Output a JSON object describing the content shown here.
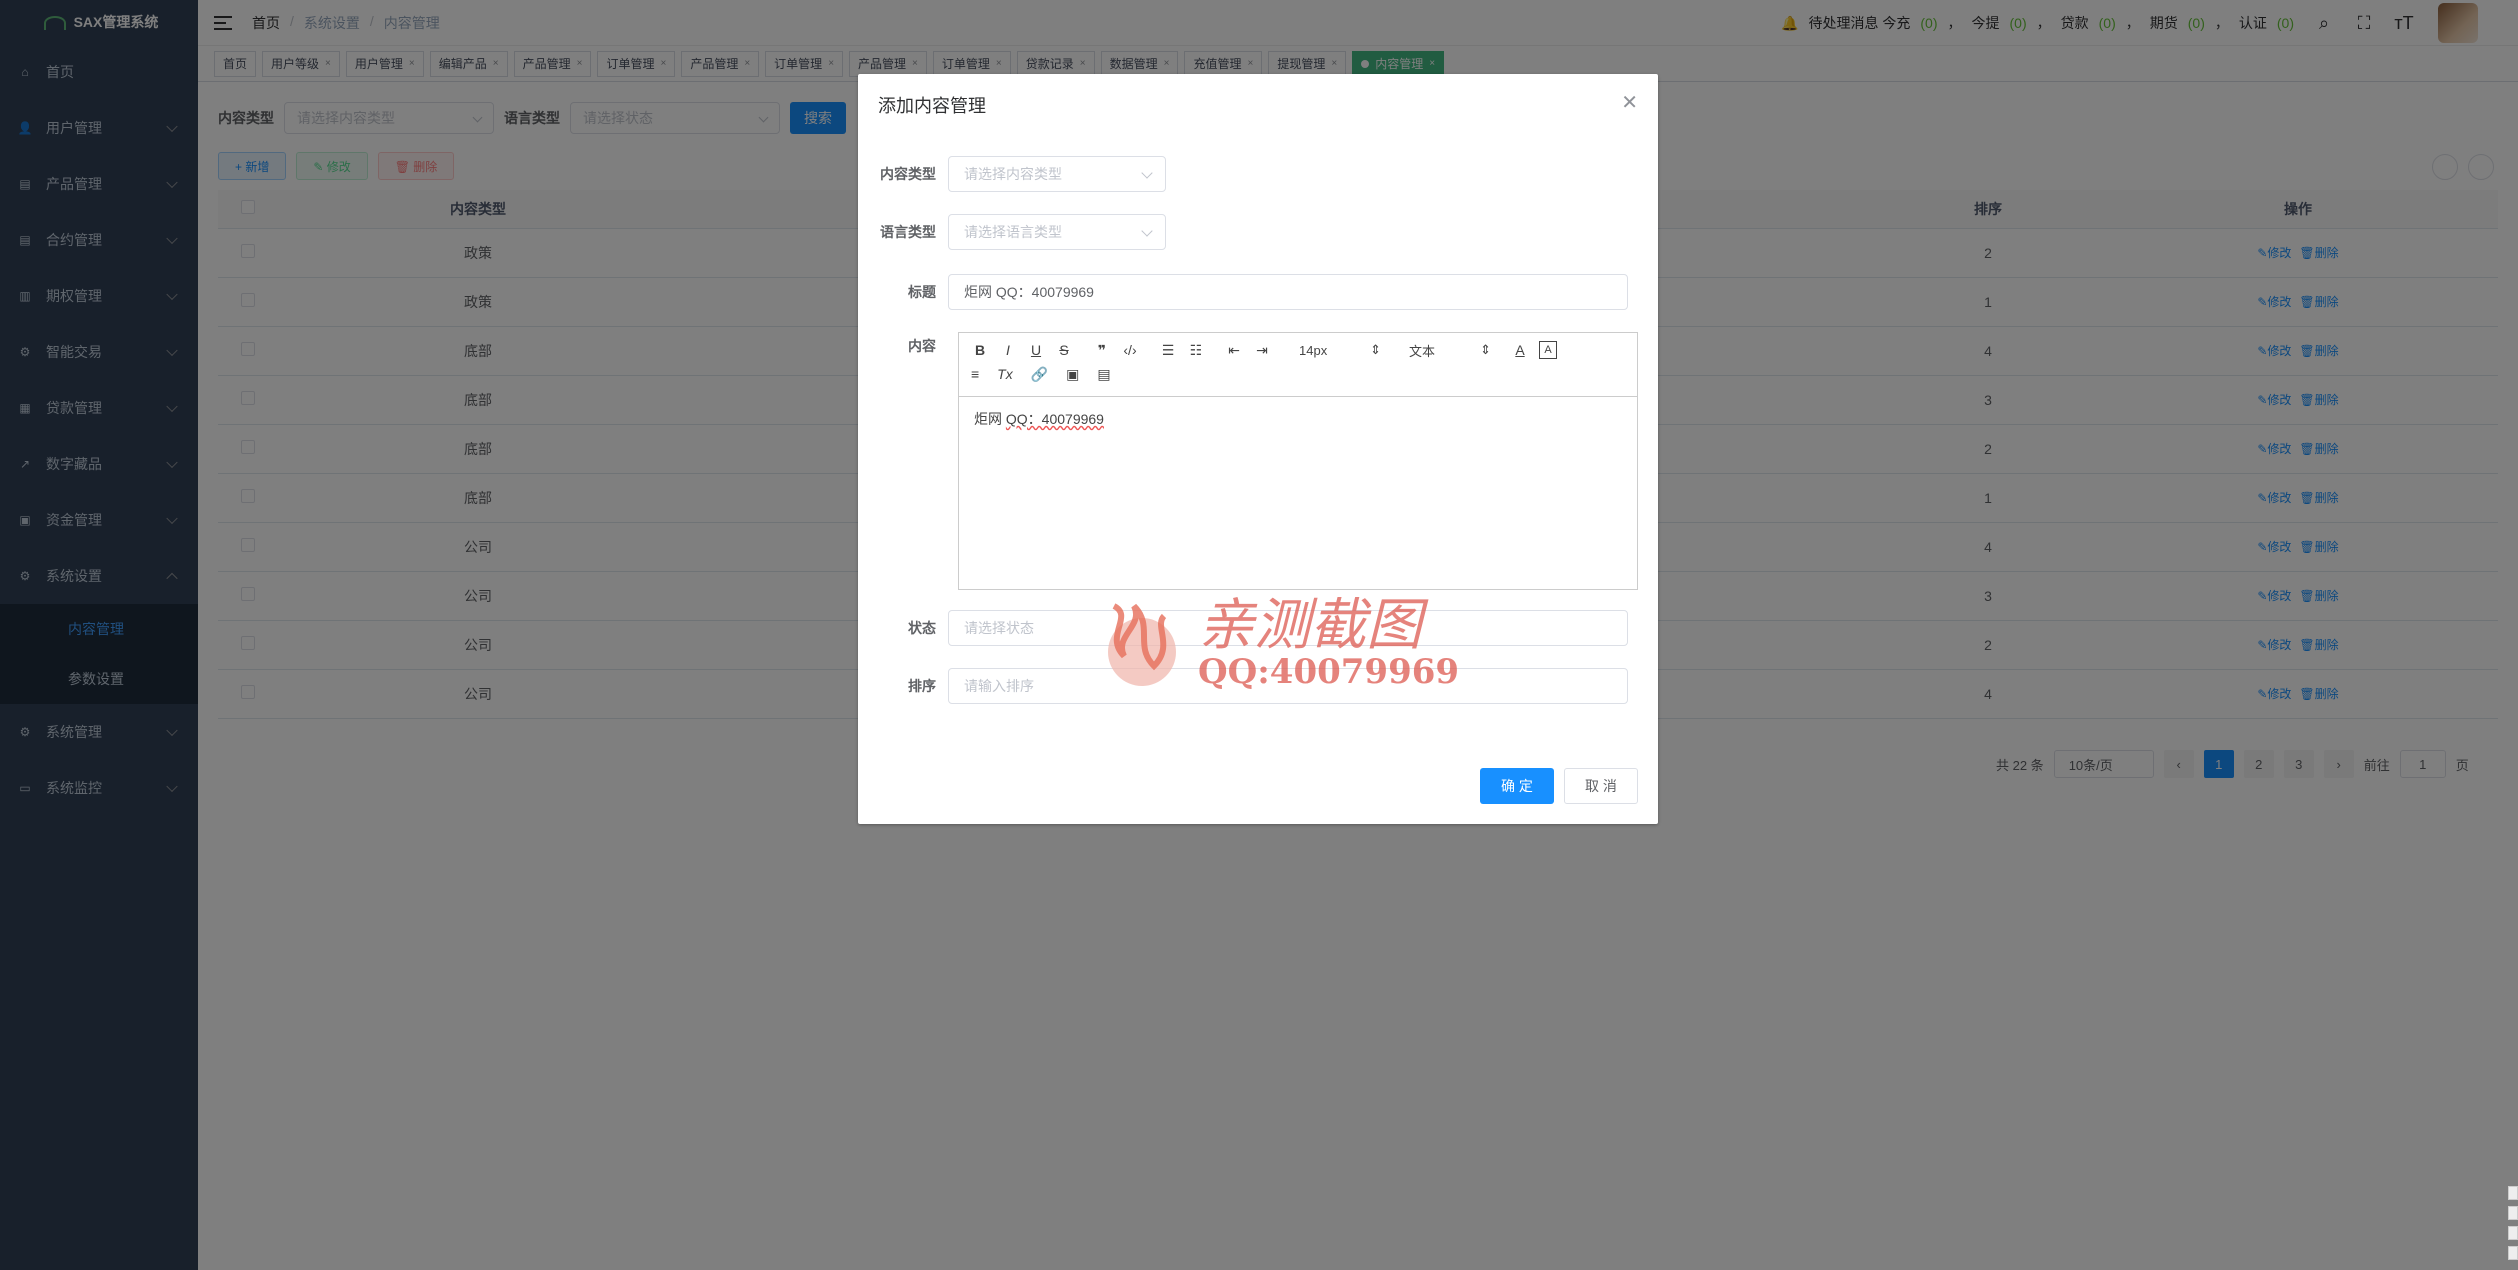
{
  "app": {
    "title": "SAX管理系统"
  },
  "sidebar": {
    "items": [
      {
        "label": "首页",
        "icon": "home-icon"
      },
      {
        "label": "用户管理",
        "icon": "user-icon"
      },
      {
        "label": "产品管理",
        "icon": "document-icon"
      },
      {
        "label": "合约管理",
        "icon": "document-icon"
      },
      {
        "label": "期权管理",
        "icon": "chart-icon"
      },
      {
        "label": "智能交易",
        "icon": "gear-icon"
      },
      {
        "label": "贷款管理",
        "icon": "wallet-icon"
      },
      {
        "label": "数字藏品",
        "icon": "trend-icon"
      },
      {
        "label": "资金管理",
        "icon": "bank-icon"
      },
      {
        "label": "系统设置",
        "icon": "gear-icon"
      }
    ],
    "submenu": [
      {
        "label": "内容管理"
      },
      {
        "label": "参数设置"
      }
    ],
    "bottom_items": [
      {
        "label": "系统管理",
        "icon": "gear-icon"
      },
      {
        "label": "系统监控",
        "icon": "monitor-icon"
      }
    ]
  },
  "topbar": {
    "breadcrumb": [
      "首页",
      "系统设置",
      "内容管理"
    ],
    "notice_label": "待处理消息 今充",
    "notice_items": [
      {
        "label": "",
        "count": "(0)"
      },
      {
        "label": "今提",
        "count": "(0)"
      },
      {
        "label": "贷款",
        "count": "(0)"
      },
      {
        "label": "期货",
        "count": "(0)"
      },
      {
        "label": "认证",
        "count": "(0)"
      }
    ]
  },
  "tags": [
    {
      "label": "首页",
      "closable": false
    },
    {
      "label": "用户等级",
      "closable": true
    },
    {
      "label": "用户管理",
      "closable": true
    },
    {
      "label": "编辑产品",
      "closable": true
    },
    {
      "label": "产品管理",
      "closable": true
    },
    {
      "label": "订单管理",
      "closable": true
    },
    {
      "label": "产品管理",
      "closable": true
    },
    {
      "label": "订单管理",
      "closable": true
    },
    {
      "label": "产品管理",
      "closable": true
    },
    {
      "label": "订单管理",
      "closable": true
    },
    {
      "label": "贷款记录",
      "closable": true
    },
    {
      "label": "数据管理",
      "closable": true
    },
    {
      "label": "充值管理",
      "closable": true
    },
    {
      "label": "提现管理",
      "closable": true
    },
    {
      "label": "内容管理",
      "closable": true,
      "active": true
    }
  ],
  "search": {
    "content_type_label": "内容类型",
    "content_type_placeholder": "请选择内容类型",
    "language_label": "语言类型",
    "language_placeholder": "请选择状态",
    "search_button": "搜索"
  },
  "actions": {
    "add": "+ 新增",
    "edit": "✎ 修改",
    "delete": "🗑 删除"
  },
  "table": {
    "headers": {
      "type": "内容类型",
      "sort": "排序",
      "ops": "操作"
    },
    "rows": [
      {
        "type": "政策",
        "sort": "2"
      },
      {
        "type": "政策",
        "sort": "1"
      },
      {
        "type": "底部",
        "sort": "4"
      },
      {
        "type": "底部",
        "sort": "3"
      },
      {
        "type": "底部",
        "sort": "2"
      },
      {
        "type": "底部",
        "sort": "1"
      },
      {
        "type": "公司",
        "sort": "4"
      },
      {
        "type": "公司",
        "sort": "3"
      },
      {
        "type": "公司",
        "sort": "2"
      },
      {
        "type": "公司",
        "sort": "4"
      }
    ],
    "edit_label": "✎修改",
    "delete_label": "🗑删除"
  },
  "pagination": {
    "total": "共 22 条",
    "page_size": "10条/页",
    "pages": [
      "1",
      "2",
      "3"
    ],
    "current": "1",
    "goto_label": "前往",
    "goto_value": "1",
    "page_suffix": "页"
  },
  "dialog": {
    "title": "添加内容管理",
    "content_type_label": "内容类型",
    "content_type_placeholder": "请选择内容类型",
    "language_label": "语言类型",
    "language_placeholder": "请选择语言类型",
    "title_label": "标题",
    "title_value": "炬网 QQ：40079969",
    "content_label": "内容",
    "editor": {
      "font_size": "14px",
      "paragraph": "文本",
      "body_prefix": "炬网 ",
      "body_underlined": "QQ：40079969"
    },
    "status_label": "状态",
    "status_placeholder": "请选择状态",
    "sort_label": "排序",
    "sort_placeholder": "请输入排序",
    "ok": "确 定",
    "cancel": "取 消"
  },
  "watermark": {
    "line1": "亲测截图",
    "line2": "QQ:40079969"
  }
}
